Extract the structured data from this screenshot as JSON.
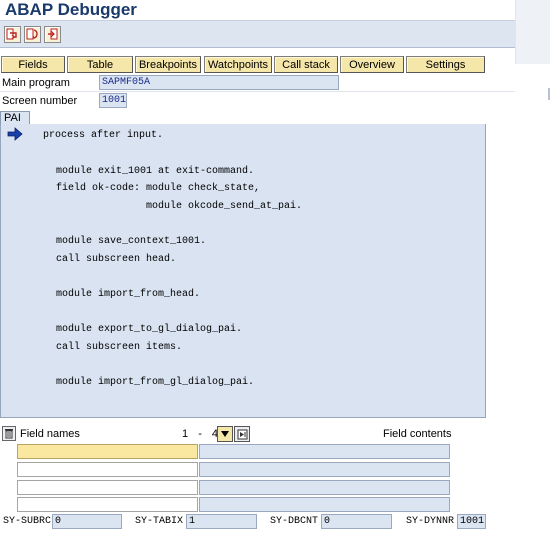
{
  "window": {
    "title": "ABAP Debugger"
  },
  "toolbar": {
    "buttons": [
      {
        "icon": "single-step-icon"
      },
      {
        "icon": "execute-icon"
      },
      {
        "icon": "return-icon"
      }
    ]
  },
  "tabs": [
    {
      "label": "Fields"
    },
    {
      "label": "Table"
    },
    {
      "label": "Breakpoints"
    },
    {
      "label": "Watchpoints"
    },
    {
      "label": "Call stack"
    },
    {
      "label": "Overview"
    },
    {
      "label": "Settings"
    }
  ],
  "header": {
    "main_program_label": "Main program",
    "main_program_value": "SAPMF05A",
    "screen_number_label": "Screen number",
    "screen_number_value": "1001"
  },
  "code": {
    "section_label": "PAI",
    "current_line_indicator": "current-line-arrow-icon",
    "lines": [
      "process after input.",
      "",
      "",
      "module exit_1001 at exit-command.",
      "field ok-code: module check_state,",
      "module okcode_send_at_pai.",
      "",
      "module save_context_1001.",
      "call subscreen head.",
      "",
      "module import_from_head.",
      "",
      "module export_to_gl_dialog_pai.",
      "call subscreen items.",
      "",
      "module import_from_gl_dialog_pai."
    ]
  },
  "field_table": {
    "names_label": "Field names",
    "contents_label": "Field contents",
    "page_from": "1",
    "page_separator": "-",
    "page_to": "4",
    "rows": [
      {
        "name": "",
        "value": ""
      },
      {
        "name": "",
        "value": ""
      },
      {
        "name": "",
        "value": ""
      },
      {
        "name": "",
        "value": ""
      }
    ]
  },
  "system_fields": [
    {
      "label": "SY-SUBRC",
      "value": "0"
    },
    {
      "label": "SY-TABIX",
      "value": "1"
    },
    {
      "label": "SY-DBCNT",
      "value": "0"
    },
    {
      "label": "SY-DYNNR",
      "value": "1001"
    }
  ],
  "colors": {
    "title": "#1a3a6b",
    "tab_background": "#f5e6a9",
    "field_background": "#dbe4f1",
    "code_background": "#d9e3f1",
    "selected_row": "#fbe8a0",
    "arrow": "#1b3fa8"
  }
}
